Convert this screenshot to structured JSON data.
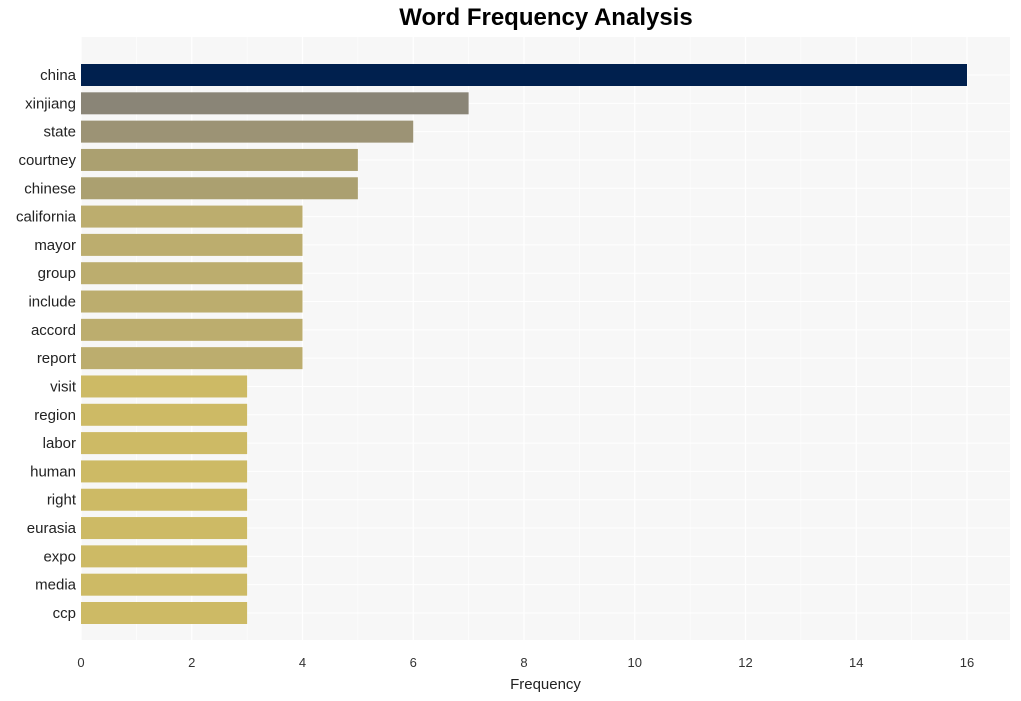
{
  "chart_data": {
    "type": "bar",
    "orientation": "horizontal",
    "title": "Word Frequency Analysis",
    "xlabel": "Frequency",
    "ylabel": "",
    "xlim": [
      0,
      16.8
    ],
    "xticks": [
      0,
      2,
      4,
      6,
      8,
      10,
      12,
      14,
      16
    ],
    "grid": true,
    "legend": "none",
    "categories": [
      "china",
      "xinjiang",
      "state",
      "courtney",
      "chinese",
      "california",
      "mayor",
      "group",
      "include",
      "accord",
      "report",
      "visit",
      "region",
      "labor",
      "human",
      "right",
      "eurasia",
      "expo",
      "media",
      "ccp"
    ],
    "values": [
      16,
      7,
      6,
      5,
      5,
      4,
      4,
      4,
      4,
      4,
      4,
      3,
      3,
      3,
      3,
      3,
      3,
      3,
      3,
      3
    ],
    "colors": {
      "16": "#00204e",
      "7": "#8a8577",
      "6": "#9c9375",
      "5": "#aba070",
      "4": "#bcad6e",
      "3": "#cdba65"
    },
    "background": "#f7f7f7",
    "gridline_color": "#ffffff"
  }
}
